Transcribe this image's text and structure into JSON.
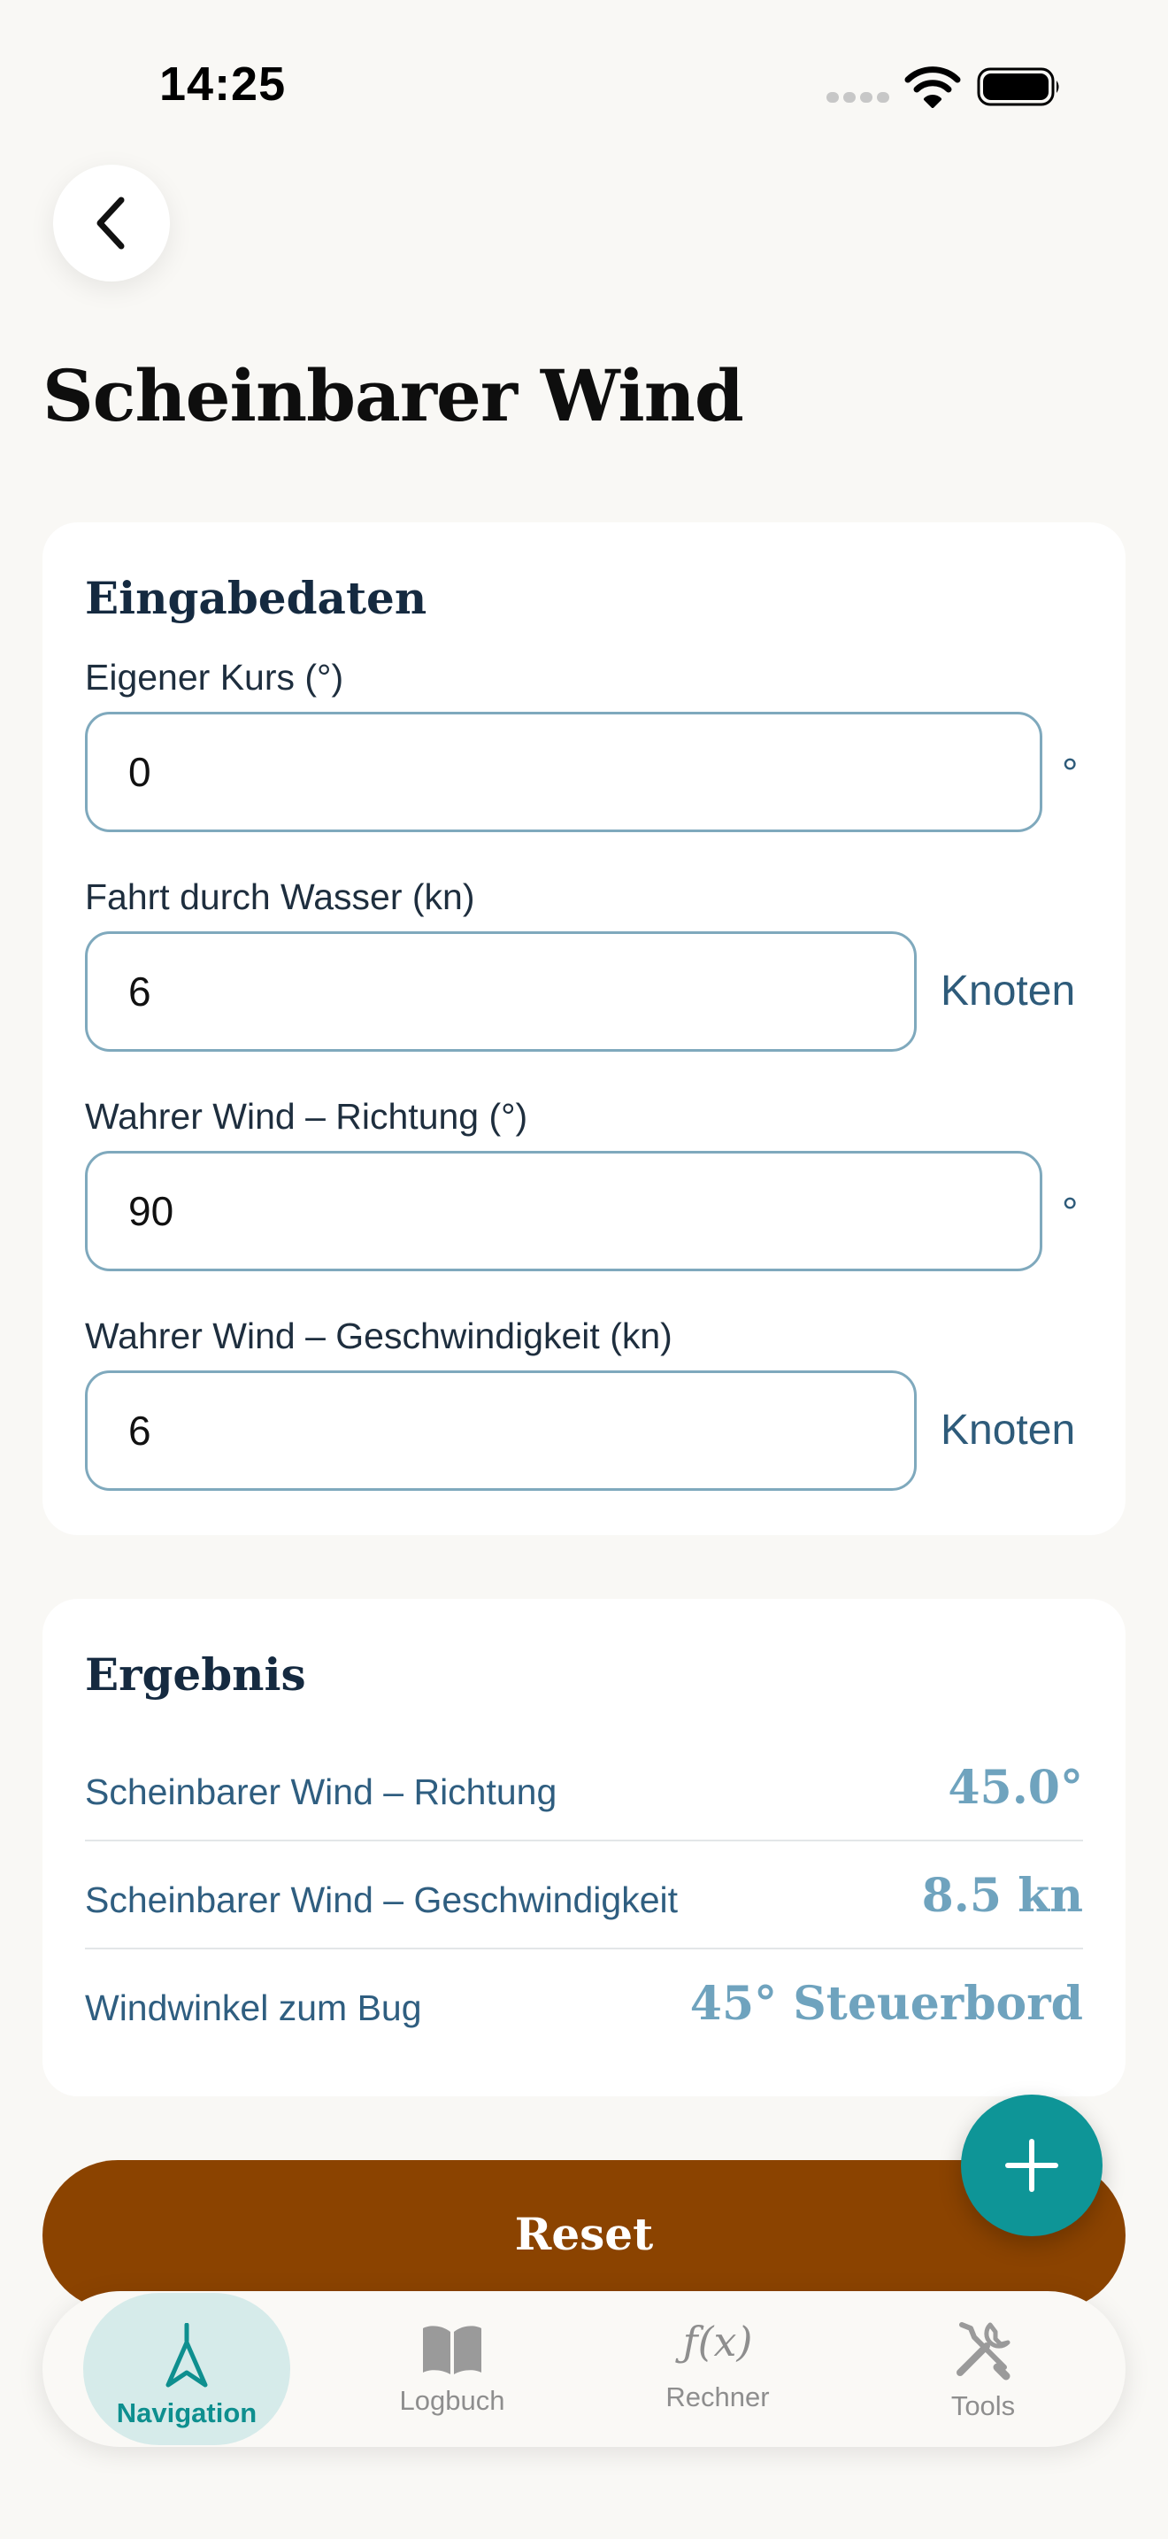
{
  "status_bar": {
    "time": "14:25",
    "icons": [
      "signal-icon",
      "wifi-icon",
      "battery-icon"
    ]
  },
  "header": {
    "back_icon": "chevron-left-icon",
    "title": "Scheinbarer Wind"
  },
  "input_card": {
    "title": "Eingabedaten",
    "fields": [
      {
        "label": "Eigener Kurs (°)",
        "value": "0",
        "unit": "°"
      },
      {
        "label": "Fahrt durch Wasser (kn)",
        "value": "6",
        "unit": "Knoten"
      },
      {
        "label": "Wahrer Wind – Richtung (°)",
        "value": "90",
        "unit": "°"
      },
      {
        "label": "Wahrer Wind – Geschwindigkeit (kn)",
        "value": "6",
        "unit": "Knoten"
      }
    ]
  },
  "result_card": {
    "title": "Ergebnis",
    "rows": [
      {
        "label": "Scheinbarer Wind – Richtung",
        "value": "45.0°"
      },
      {
        "label": "Scheinbarer Wind – Geschwindigkeit",
        "value": "8.5 kn"
      },
      {
        "label": "Windwinkel zum Bug",
        "value": "45° Steuerbord"
      }
    ]
  },
  "actions": {
    "reset_label": "Reset",
    "fab_icon": "plus-icon"
  },
  "tab_bar": {
    "tabs": [
      {
        "label": "Navigation",
        "icon": "navigation-arrow-icon",
        "active": true
      },
      {
        "label": "Logbuch",
        "icon": "book-icon",
        "active": false
      },
      {
        "label": "Rechner",
        "icon": "function-icon",
        "glyph": "ƒ(x)",
        "active": false
      },
      {
        "label": "Tools",
        "icon": "tools-icon",
        "active": false
      }
    ]
  },
  "colors": {
    "background": "#F9F8F5",
    "card": "#FFFFFF",
    "input_border": "#7FA9BD",
    "result_value": "#6FA3BE",
    "reset_button": "#8B4300",
    "fab": "#0E9597",
    "tab_active_bg": "#D6EBEA",
    "tab_active_text": "#0E8F8F"
  }
}
